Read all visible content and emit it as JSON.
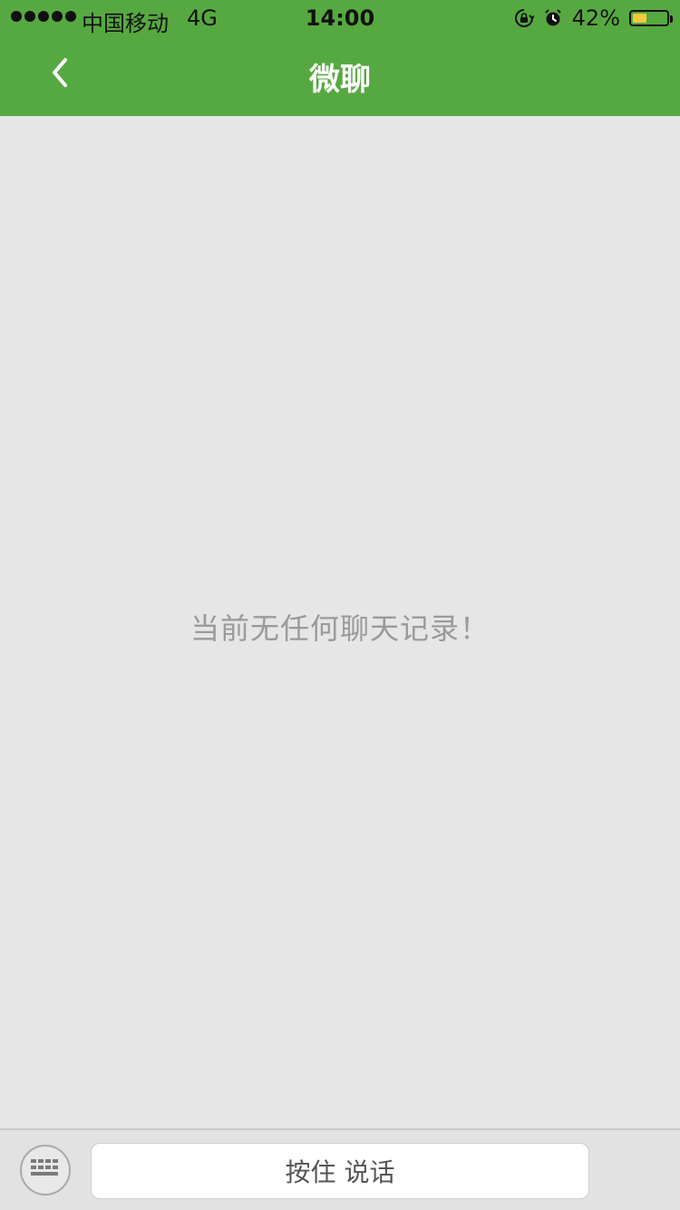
{
  "status_bar": {
    "carrier": "中国移动",
    "network": "4G",
    "time": "14:00",
    "battery_percent_label": "42%",
    "battery_level": 0.42,
    "icons": [
      "orientation-lock-icon",
      "alarm-icon"
    ]
  },
  "navbar": {
    "title": "微聊",
    "back_icon": "chevron-left-icon",
    "background_color": "#56a941"
  },
  "content": {
    "empty_message": "当前无任何聊天记录！"
  },
  "input_bar": {
    "keyboard_icon": "keyboard-icon",
    "hold_to_talk_label": "按住 说话"
  }
}
